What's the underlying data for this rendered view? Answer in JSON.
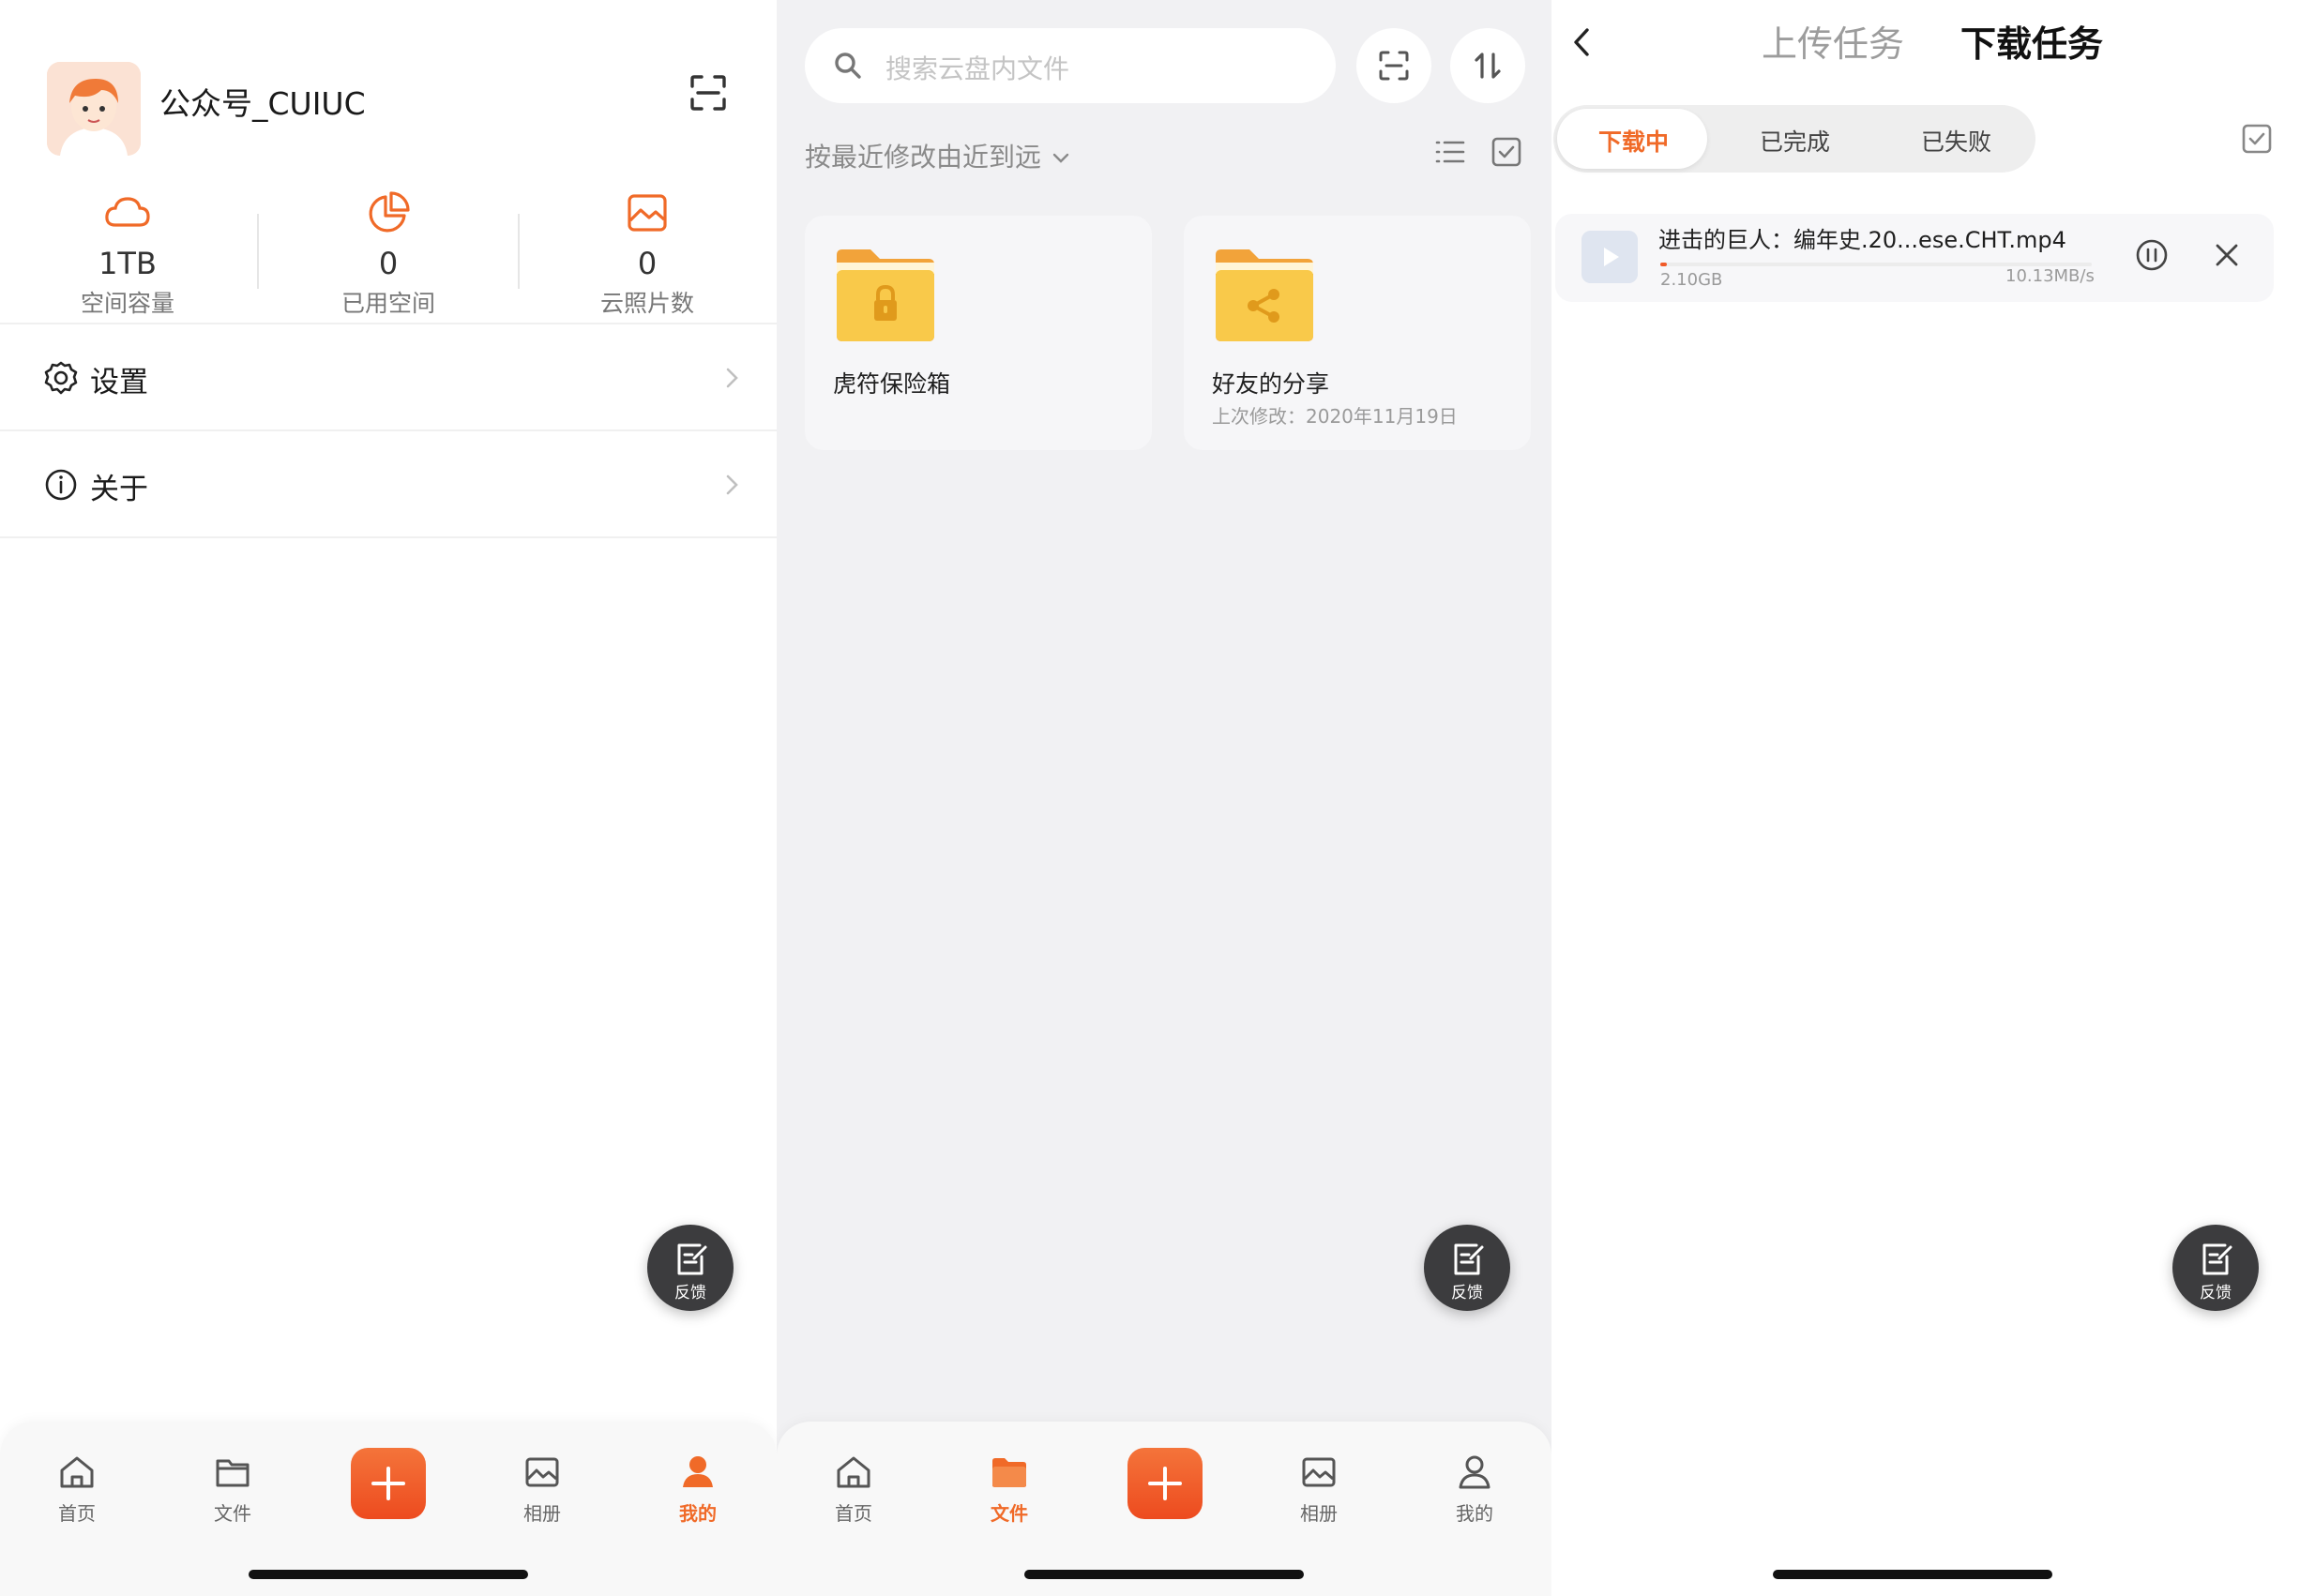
{
  "profile": {
    "username": "公众号_CUIUC",
    "stats": [
      {
        "icon": "cloud-icon",
        "value": "1TB",
        "label": "空间容量"
      },
      {
        "icon": "pie-chart-icon",
        "value": "0",
        "label": "已用空间"
      },
      {
        "icon": "image-icon",
        "value": "0",
        "label": "云照片数"
      }
    ],
    "menu": [
      {
        "icon": "gear-icon",
        "label": "设置"
      },
      {
        "icon": "info-icon",
        "label": "关于"
      }
    ]
  },
  "feedback": {
    "label": "反馈"
  },
  "tabbar": {
    "items": [
      {
        "icon": "home-icon",
        "label": "首页"
      },
      {
        "icon": "folder-icon",
        "label": "文件"
      },
      {
        "icon": "plus-icon",
        "label": ""
      },
      {
        "icon": "image-icon",
        "label": "相册"
      },
      {
        "icon": "person-icon",
        "label": "我的"
      }
    ],
    "active_panel1": "我的",
    "active_panel2": "文件"
  },
  "files": {
    "search_placeholder": "搜索云盘内文件",
    "sort_label": "按最近修改由近到远",
    "items": [
      {
        "name": "虎符保险箱",
        "modified": "",
        "icon": "locked-folder-icon"
      },
      {
        "name": "好友的分享",
        "modified": "上次修改：2020年11月19日",
        "icon": "shared-folder-icon"
      }
    ]
  },
  "tasks": {
    "tab_upload": "上传任务",
    "tab_download": "下载任务",
    "segments": [
      "下载中",
      "已完成",
      "已失败"
    ],
    "active_segment": "下载中",
    "download": {
      "filename": "进击的巨人：编年史.20...ese.CHT.mp4",
      "size": "2.10GB",
      "speed": "10.13MB/s",
      "progress": 0.015
    }
  },
  "colors": {
    "accent": "#f05a28",
    "folder": "#f7c545",
    "fab": "#3c3c3e"
  }
}
